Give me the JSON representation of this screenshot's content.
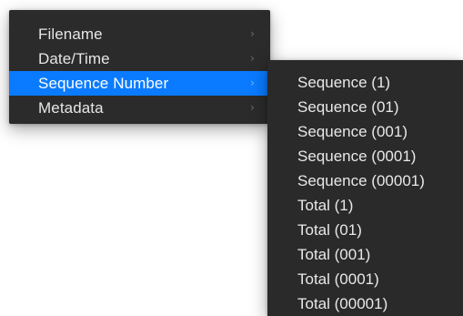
{
  "main_menu": {
    "items": [
      {
        "label": "Filename",
        "chevron": "›"
      },
      {
        "label": "Date/Time",
        "chevron": "›"
      },
      {
        "label": "Sequence Number",
        "chevron": "›"
      },
      {
        "label": "Metadata",
        "chevron": "›"
      }
    ]
  },
  "submenu": {
    "items": [
      {
        "label": "Sequence (1)"
      },
      {
        "label": "Sequence (01)"
      },
      {
        "label": "Sequence (001)"
      },
      {
        "label": "Sequence (0001)"
      },
      {
        "label": "Sequence (00001)"
      },
      {
        "label": "Total (1)"
      },
      {
        "label": "Total (01)"
      },
      {
        "label": "Total (001)"
      },
      {
        "label": "Total (0001)"
      },
      {
        "label": "Total (00001)"
      }
    ]
  },
  "colors": {
    "menu_background": "#2b2b2b",
    "highlight": "#0a7bff",
    "text": "#e6e6e6",
    "chevron": "#6f6f6f"
  }
}
